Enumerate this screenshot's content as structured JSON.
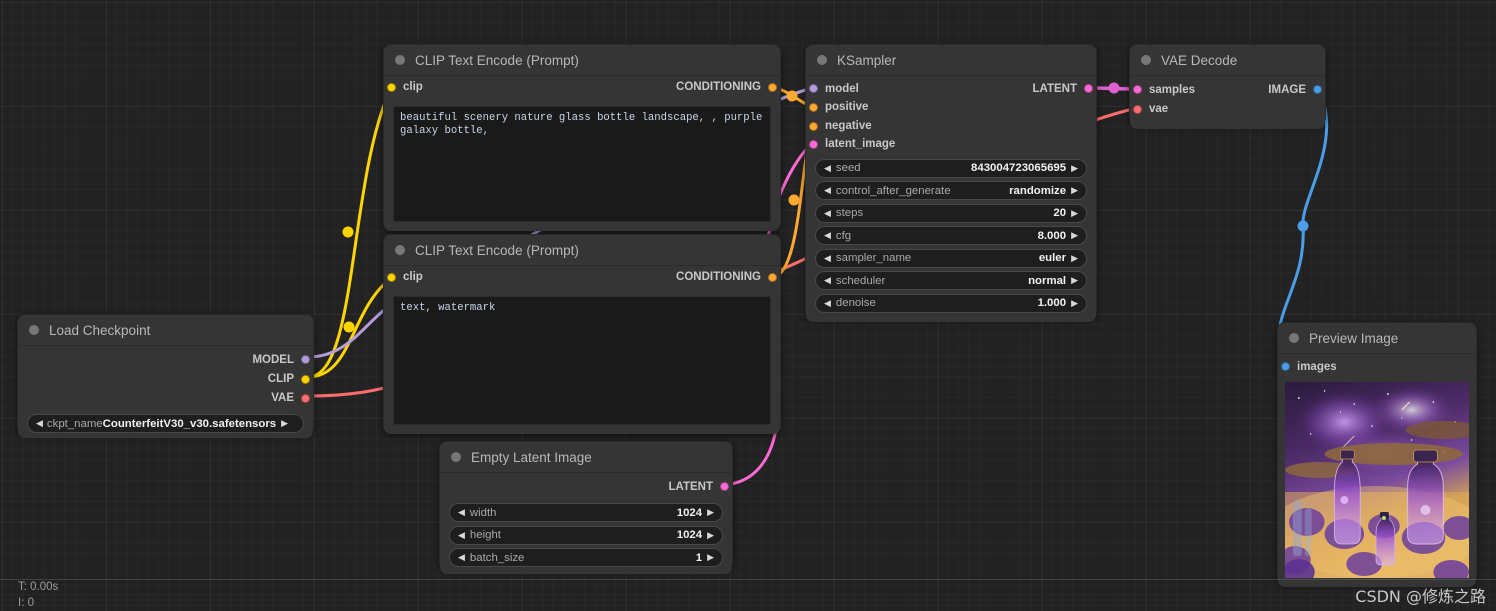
{
  "app": {
    "background": "#222222",
    "node_bg": "#353535",
    "status_time": "T: 0.00s",
    "status_images": "I: 0",
    "watermark": "CSDN @修炼之路"
  },
  "colors": {
    "clip": "#FFD500",
    "model": "#B39DDB",
    "vae": "#FF6E6E",
    "conditioning": "#FFA931",
    "latent": "#FF6BD6",
    "image": "#64B5F6"
  },
  "nodes": {
    "clip_positive": {
      "title": "CLIP Text Encode (Prompt)",
      "input_label": "clip",
      "output_label": "CONDITIONING",
      "text": "beautiful scenery nature glass bottle landscape, , purple galaxy bottle,"
    },
    "clip_negative": {
      "title": "CLIP Text Encode (Prompt)",
      "input_label": "clip",
      "output_label": "CONDITIONING",
      "text": "text, watermark"
    },
    "ksampler": {
      "title": "KSampler",
      "inputs": [
        "model",
        "positive",
        "negative",
        "latent_image"
      ],
      "output_label": "LATENT",
      "widgets": [
        {
          "name": "seed",
          "value": "843004723065695"
        },
        {
          "name": "control_after_generate",
          "value": "randomize"
        },
        {
          "name": "steps",
          "value": "20"
        },
        {
          "name": "cfg",
          "value": "8.000"
        },
        {
          "name": "sampler_name",
          "value": "euler"
        },
        {
          "name": "scheduler",
          "value": "normal"
        },
        {
          "name": "denoise",
          "value": "1.000"
        }
      ]
    },
    "vae_decode": {
      "title": "VAE Decode",
      "inputs": [
        "samples",
        "vae"
      ],
      "output_label": "IMAGE"
    },
    "load_checkpoint": {
      "title": "Load Checkpoint",
      "outputs": [
        "MODEL",
        "CLIP",
        "VAE"
      ],
      "widget": {
        "name": "ckpt_name",
        "value": "CounterfeitV30_v30.safetensors"
      }
    },
    "empty_latent": {
      "title": "Empty Latent Image",
      "output_label": "LATENT",
      "widgets": [
        {
          "name": "width",
          "value": "1024"
        },
        {
          "name": "height",
          "value": "1024"
        },
        {
          "name": "batch_size",
          "value": "1"
        }
      ]
    },
    "preview_image": {
      "title": "Preview Image",
      "input_label": "images"
    }
  },
  "icons": {
    "collapse": "collapse-dot-icon",
    "left_arrow": "◀",
    "right_arrow": "▶"
  }
}
